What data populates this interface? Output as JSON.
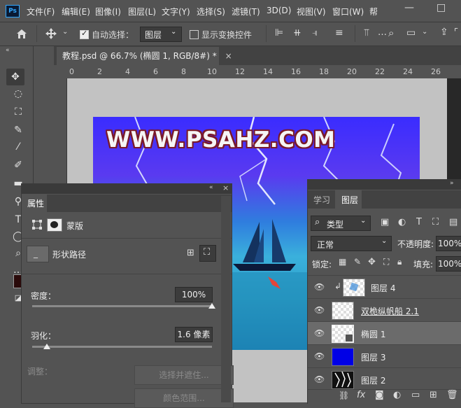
{
  "app": {
    "logo": "Ps",
    "menu": [
      "文件(F)",
      "编辑(E)",
      "图像(I)",
      "图层(L)",
      "文字(Y)",
      "选择(S)",
      "滤镜(T)",
      "3D(D)",
      "视图(V)",
      "窗口(W)",
      "帮"
    ],
    "window_controls": [
      "—",
      "□"
    ]
  },
  "options_bar": {
    "auto_select_label": "自动选择：",
    "auto_select_checked": true,
    "auto_select_target": "图层",
    "show_transform_label": "显示变换控件",
    "show_transform_checked": false
  },
  "document": {
    "tab_title": "教程.psd @ 66.7% (椭圆 1, RGB/8#) *",
    "ruler_marks": [
      "0",
      "2",
      "4",
      "6",
      "8",
      "10",
      "12",
      "14",
      "16",
      "18",
      "20",
      "22",
      "24",
      "26"
    ],
    "canvas_text": "WWW.PSAHZ.COM"
  },
  "properties_panel": {
    "tab": "属性",
    "mask_type": "蒙版",
    "section_label": "形状路径",
    "density_label": "密度：",
    "density_value": "100%",
    "density_fraction": 1.0,
    "feather_label": "羽化：",
    "feather_value": "1.6 像素",
    "feather_fraction": 0.08,
    "adjust_label": "调整：",
    "select_and_mask_button": "选择并遮住...",
    "color_range_button": "颜色范围..."
  },
  "layers_panel": {
    "tabs": [
      "学习",
      "图层"
    ],
    "active_tab": "图层",
    "filter_kind": "类型",
    "blend_mode": "正常",
    "opacity_label": "不透明度:",
    "opacity_value": "100%",
    "lock_label": "锁定:",
    "fill_label": "填充:",
    "fill_value": "100%",
    "layers": [
      {
        "name": "图层 4",
        "selected": false
      },
      {
        "name": "双桅纵帆船 2.1",
        "selected": false
      },
      {
        "name": "椭圆 1",
        "selected": true
      },
      {
        "name": "图层 3",
        "selected": false
      },
      {
        "name": "图层 2",
        "selected": false
      }
    ],
    "colors": {
      "selected_row": "#6b6b6b",
      "layer3_thumb": "#0000e6"
    }
  }
}
